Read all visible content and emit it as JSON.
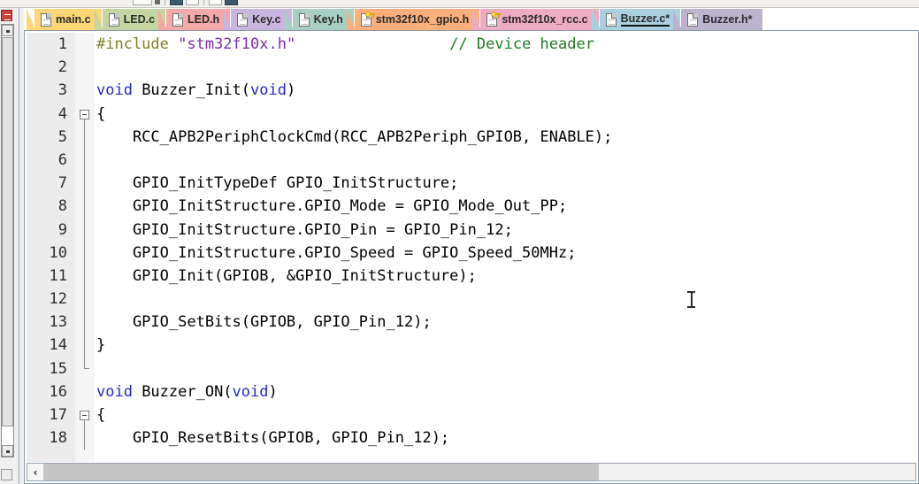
{
  "window": {
    "title": "Buzzer.c",
    "type": "code-editor"
  },
  "toolbar": {
    "visible_partial": true
  },
  "left_panel": {
    "icon": "project-window-icon",
    "scrollbar": "vertical-scrollbar"
  },
  "tabs": [
    {
      "label": "main.c",
      "color": "#fcd775",
      "icon": "document-icon",
      "has_key": false,
      "active": false
    },
    {
      "label": "LED.c",
      "color": "#c5d6a3",
      "icon": "document-icon",
      "has_key": false,
      "active": false
    },
    {
      "label": "LED.h",
      "color": "#f4a8a8",
      "icon": "document-icon",
      "has_key": false,
      "active": false
    },
    {
      "label": "Key.c",
      "color": "#c9b6e0",
      "icon": "document-icon",
      "has_key": false,
      "active": false
    },
    {
      "label": "Key.h",
      "color": "#a8cfc4",
      "icon": "document-icon",
      "has_key": false,
      "active": false
    },
    {
      "label": "stm32f10x_gpio.h",
      "color": "#fbb07c",
      "icon": "document-icon",
      "has_key": true,
      "active": false
    },
    {
      "label": "stm32f10x_rcc.c",
      "color": "#eeacc3",
      "icon": "document-icon",
      "has_key": true,
      "active": false
    },
    {
      "label": "Buzzer.c*",
      "color": "#a9cfe0",
      "icon": "document-icon",
      "has_key": false,
      "active": true
    },
    {
      "label": "Buzzer.h*",
      "color": "#bcb4cf",
      "icon": "document-icon",
      "has_key": false,
      "active": false
    }
  ],
  "editor": {
    "font": "monospace",
    "colors": {
      "preprocessor": "#7f7f23",
      "string": "#7b2fa8",
      "keyword": "#2727c8",
      "comment": "#207a20",
      "plain": "#000000",
      "gutter_bg": "#ececec",
      "fold_bg": "#f5f5f5",
      "background": "#ffffff"
    },
    "lines": [
      {
        "num": "1",
        "fold": "none",
        "segments": [
          {
            "text": "#include ",
            "style": "preprocessor"
          },
          {
            "text": "\"stm32f10x.h\"",
            "style": "string"
          },
          {
            "text": "                 ",
            "style": "plain"
          },
          {
            "text": "// Device header",
            "style": "comment"
          }
        ]
      },
      {
        "num": "2",
        "fold": "none",
        "segments": []
      },
      {
        "num": "3",
        "fold": "none",
        "segments": [
          {
            "text": "void",
            "style": "keyword"
          },
          {
            "text": " Buzzer_Init(",
            "style": "plain"
          },
          {
            "text": "void",
            "style": "keyword"
          },
          {
            "text": ")",
            "style": "plain"
          }
        ]
      },
      {
        "num": "4",
        "fold": "box",
        "segments": [
          {
            "text": "{",
            "style": "plain"
          }
        ]
      },
      {
        "num": "5",
        "fold": "line",
        "segments": [
          {
            "text": "    RCC_APB2PeriphClockCmd(RCC_APB2Periph_GPIOB, ENABLE);",
            "style": "plain"
          }
        ]
      },
      {
        "num": "6",
        "fold": "line",
        "segments": []
      },
      {
        "num": "7",
        "fold": "line",
        "segments": [
          {
            "text": "    GPIO_InitTypeDef GPIO_InitStructure;",
            "style": "plain"
          }
        ]
      },
      {
        "num": "8",
        "fold": "line",
        "segments": [
          {
            "text": "    GPIO_InitStructure.GPIO_Mode = GPIO_Mode_Out_PP;",
            "style": "plain"
          }
        ]
      },
      {
        "num": "9",
        "fold": "line",
        "segments": [
          {
            "text": "    GPIO_InitStructure.GPIO_Pin = GPIO_Pin_12;",
            "style": "plain"
          }
        ]
      },
      {
        "num": "10",
        "fold": "line",
        "segments": [
          {
            "text": "    GPIO_InitStructure.GPIO_Speed = GPIO_Speed_50MHz;",
            "style": "plain"
          }
        ]
      },
      {
        "num": "11",
        "fold": "line",
        "segments": [
          {
            "text": "    GPIO_Init(GPIOB, &GPIO_InitStructure);",
            "style": "plain"
          }
        ]
      },
      {
        "num": "12",
        "fold": "line",
        "segments": []
      },
      {
        "num": "13",
        "fold": "line",
        "segments": [
          {
            "text": "    GPIO_SetBits(GPIOB, GPIO_Pin_12);",
            "style": "plain"
          }
        ]
      },
      {
        "num": "14",
        "fold": "line",
        "segments": [
          {
            "text": "}",
            "style": "plain"
          }
        ]
      },
      {
        "num": "15",
        "fold": "end",
        "segments": []
      },
      {
        "num": "16",
        "fold": "none",
        "segments": [
          {
            "text": "void",
            "style": "keyword"
          },
          {
            "text": " Buzzer_ON(",
            "style": "plain"
          },
          {
            "text": "void",
            "style": "keyword"
          },
          {
            "text": ")",
            "style": "plain"
          }
        ]
      },
      {
        "num": "17",
        "fold": "box",
        "segments": [
          {
            "text": "{",
            "style": "plain"
          }
        ]
      },
      {
        "num": "18",
        "fold": "line",
        "segments": [
          {
            "text": "    GPIO_ResetBits(GPIOB, GPIO_Pin_12);",
            "style": "plain"
          }
        ]
      }
    ]
  },
  "cursor": {
    "type": "i-beam",
    "line": "10"
  },
  "hscrollbar": {
    "left_arrow": "‹",
    "thumb_present": true
  }
}
